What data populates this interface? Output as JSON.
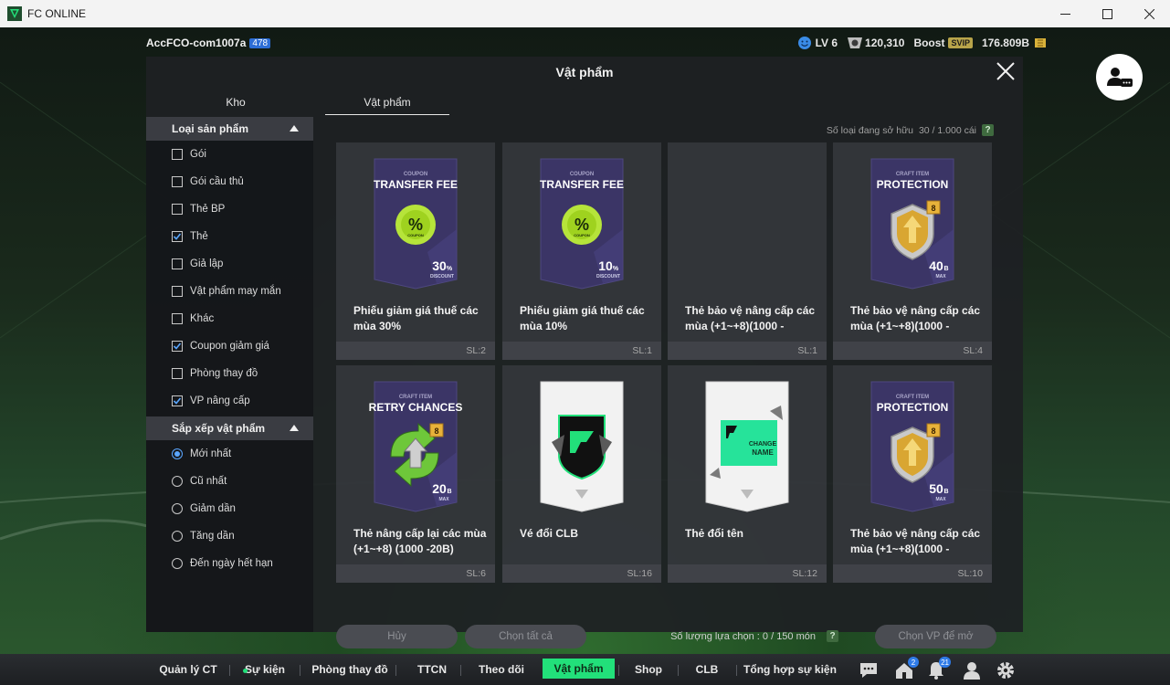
{
  "window": {
    "title": "FC ONLINE"
  },
  "topbar": {
    "account_name": "AccFCO-com1007a",
    "account_level_badge": "478",
    "level": "LV 6",
    "coins": "120,310",
    "boost_label": "Boost",
    "svip_label": "SVIP",
    "bp": "176.809B"
  },
  "modal": {
    "title": "Vật phẩm",
    "tabs": [
      {
        "label": "Kho",
        "active": false
      },
      {
        "label": "Vật phẩm",
        "active": true
      }
    ],
    "owned_label": "Số loại đang sở hữu",
    "owned_value": "30 / 1.000 cái",
    "help_glyph": "?"
  },
  "sidebar": {
    "product_type_header": "Loại sản phẩm",
    "product_types": [
      {
        "label": "Gói",
        "checked": false
      },
      {
        "label": "Gói cầu thủ",
        "checked": false
      },
      {
        "label": "Thẻ BP",
        "checked": false
      },
      {
        "label": "Thẻ",
        "checked": true
      },
      {
        "label": "Giả lập",
        "checked": false
      },
      {
        "label": "Vật phẩm may mắn",
        "checked": false
      },
      {
        "label": "Khác",
        "checked": false
      },
      {
        "label": "Coupon giảm giá",
        "checked": true
      },
      {
        "label": "Phòng thay đồ",
        "checked": false
      },
      {
        "label": "VP nâng cấp",
        "checked": true
      }
    ],
    "sort_header": "Sắp xếp vật phẩm",
    "sort_options": [
      {
        "label": "Mới nhất",
        "selected": true
      },
      {
        "label": "Cũ nhất",
        "selected": false
      },
      {
        "label": "Giảm dần",
        "selected": false
      },
      {
        "label": "Tăng dần",
        "selected": false
      },
      {
        "label": "Đến ngày hết hạn",
        "selected": false
      }
    ]
  },
  "items": [
    {
      "name": "Phiếu giảm giá thuế các mùa 30%",
      "qty": "SL:2",
      "art": "coupon",
      "art_small": "COUPON",
      "art_title": "TRANSFER FEE",
      "art_value": "30",
      "art_unit": "%",
      "art_sub": "DISCOUNT",
      "art_badge": "COUPON"
    },
    {
      "name": "Phiếu giảm giá thuế các mùa 10%",
      "qty": "SL:1",
      "art": "coupon",
      "art_small": "COUPON",
      "art_title": "TRANSFER FEE",
      "art_value": "10",
      "art_unit": "%",
      "art_sub": "DISCOUNT",
      "art_badge": "COUPON"
    },
    {
      "name": "Thẻ bảo vệ nâng cấp các mùa (+1~+8)(1000 -",
      "qty": "SL:1",
      "art": "empty"
    },
    {
      "name": "Thẻ bảo vệ nâng cấp các mùa (+1~+8)(1000 -",
      "qty": "SL:4",
      "art": "protection",
      "art_small": "CRAFT ITEM",
      "art_title": "PROTECTION",
      "art_value": "40",
      "art_unit": "B",
      "art_sub": "MAX",
      "art_badge": "8"
    },
    {
      "name": "Thẻ nâng cấp lại các mùa (+1~+8) (1000 -20B)",
      "qty": "SL:6",
      "art": "retry",
      "art_small": "CRAFT ITEM",
      "art_title": "RETRY CHANCES",
      "art_value": "20",
      "art_unit": "B",
      "art_sub": "MAX",
      "art_badge": "8"
    },
    {
      "name": "Vé đổi CLB",
      "qty": "SL:16",
      "art": "club"
    },
    {
      "name": "Thẻ đổi tên",
      "qty": "SL:12",
      "art": "rename",
      "art_title": "CHANGE",
      "art_value": "NAME"
    },
    {
      "name": "Thẻ bảo vệ nâng cấp các mùa (+1~+8)(1000 -",
      "qty": "SL:10",
      "art": "protection",
      "art_small": "CRAFT ITEM",
      "art_title": "PROTECTION",
      "art_value": "50",
      "art_unit": "B",
      "art_sub": "MAX",
      "art_badge": "8"
    }
  ],
  "footer": {
    "cancel_label": "Hủy",
    "select_all_label": "Chọn tất cả",
    "selection_count_label": "Số lượng lựa chọn : 0 / 150 món",
    "confirm_label": "Chọn VP để mở"
  },
  "bottomnav": {
    "items": [
      {
        "label": "Quản lý CT",
        "active": false
      },
      {
        "label": "Sự kiện",
        "active": false
      },
      {
        "label": "Phòng thay đồ",
        "active": false
      },
      {
        "label": "TTCN",
        "active": false
      },
      {
        "label": "Theo dõi",
        "active": false
      },
      {
        "label": "Vật phẩm",
        "active": true
      },
      {
        "label": "Shop",
        "active": false
      },
      {
        "label": "CLB",
        "active": false
      },
      {
        "label": "Tổng hợp sự kiện",
        "active": false
      }
    ],
    "home_badge": "2",
    "bell_badge": "21"
  },
  "colors": {
    "accent": "#22e07a",
    "card_purple": "#3b3566",
    "coupon_green": "#b6e43a",
    "radio_blue": "#5aa6ff"
  },
  "icons": [
    "fc-logo-icon",
    "minimize-icon",
    "maximize-icon",
    "close-icon",
    "smiley-icon",
    "coin-icon",
    "bp-icon",
    "support-chat-icon",
    "checkbox-icon",
    "radio-icon",
    "chat-icon",
    "home-icon",
    "bell-icon",
    "profile-icon",
    "settings-icon"
  ]
}
